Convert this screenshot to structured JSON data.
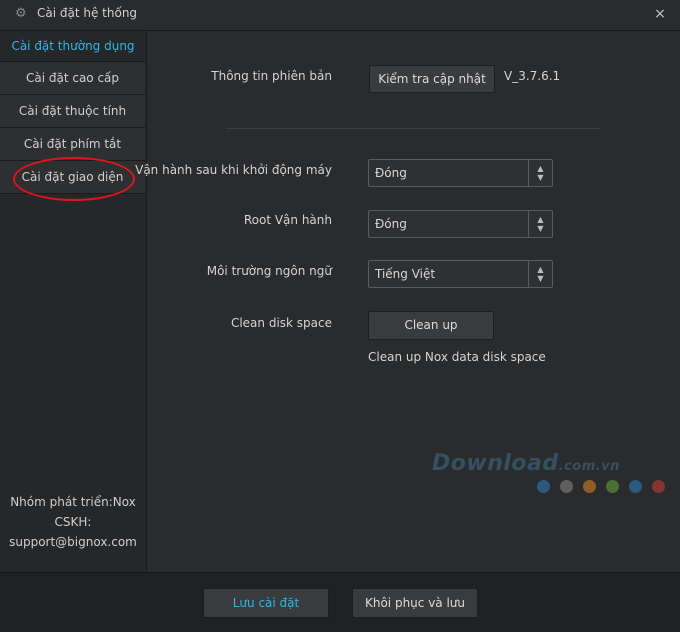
{
  "window": {
    "title": "Cài đặt hệ thống",
    "icon": "gear-icon",
    "close_glyph": "×"
  },
  "sidebar": {
    "active_label": "Cài đặt thường dụng",
    "items": [
      {
        "label": "Cài đặt cao cấp"
      },
      {
        "label": "Cài đặt thuộc tính"
      },
      {
        "label": "Cài đặt phím tắt"
      },
      {
        "label": "Cài đặt giao diện"
      }
    ],
    "footer": {
      "line1": "Nhóm phát triển:Nox",
      "line2": "CSKH:",
      "line3": "support@bignox.com"
    }
  },
  "main": {
    "version_label": "Thông tin phiên bản",
    "check_update_button": "Kiểm tra cập nhật",
    "version_value": "V_3.7.6.1",
    "startup_label": "Vận hành sau khi khởi động máy",
    "startup_value": "Đóng",
    "root_label": "Root Vận hành",
    "root_value": "Đóng",
    "language_label": "Môi trường ngôn ngữ",
    "language_value": "Tiếng Việt",
    "clean_label": "Clean disk space",
    "clean_button": "Clean up",
    "clean_desc": "Clean up Nox data disk space"
  },
  "watermark": {
    "text": "Download",
    "suffix": ".com.vn",
    "dot_colors": [
      "#2d7fc1",
      "#8a8a8a",
      "#e08a1e",
      "#6aa83a",
      "#2d7fc1",
      "#d03a3a"
    ]
  },
  "footer": {
    "save_button": "Lưu cài đặt",
    "restore_button": "Khôi phục và lưu"
  },
  "colors": {
    "accent": "#2fb6e6",
    "highlight_ring": "#e0141e",
    "background": "#2a2b2d"
  }
}
